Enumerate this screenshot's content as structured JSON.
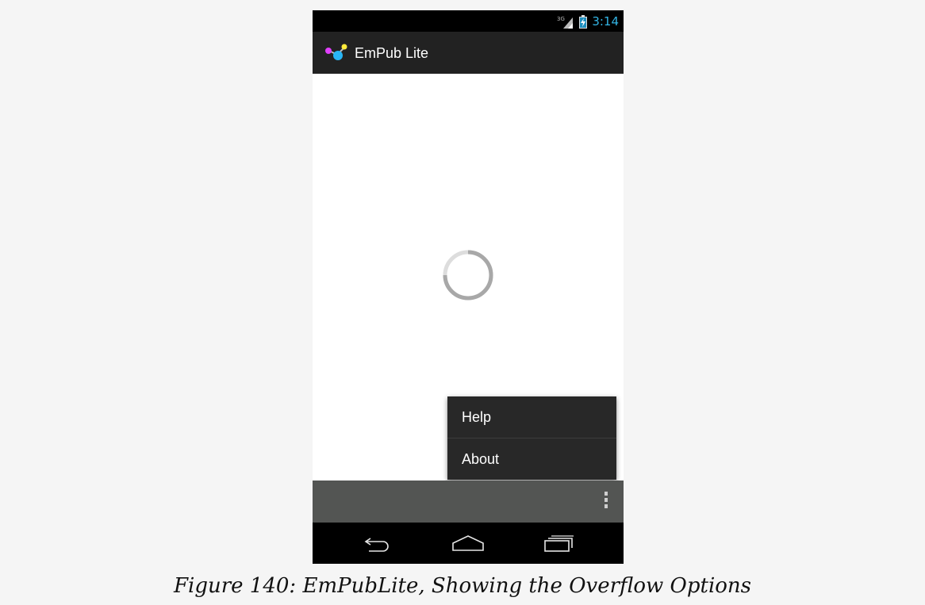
{
  "status_bar": {
    "time": "3:14",
    "network_label": "3G",
    "time_color": "#33b5e5",
    "icons": [
      "signal-icon",
      "battery-charging-icon"
    ]
  },
  "action_bar": {
    "title": "EmPub Lite",
    "icon": "app-logo-icon"
  },
  "content": {
    "loading_indicator": "progress-spinner"
  },
  "overflow_menu": {
    "items": [
      {
        "label": "Help"
      },
      {
        "label": "About"
      }
    ]
  },
  "split_action_bar": {
    "overflow_icon": "overflow-dots-icon"
  },
  "navigation_bar": {
    "buttons": [
      "back-icon",
      "home-icon",
      "recents-icon"
    ]
  },
  "caption": "Figure 140: EmPubLite, Showing the Overflow Options"
}
